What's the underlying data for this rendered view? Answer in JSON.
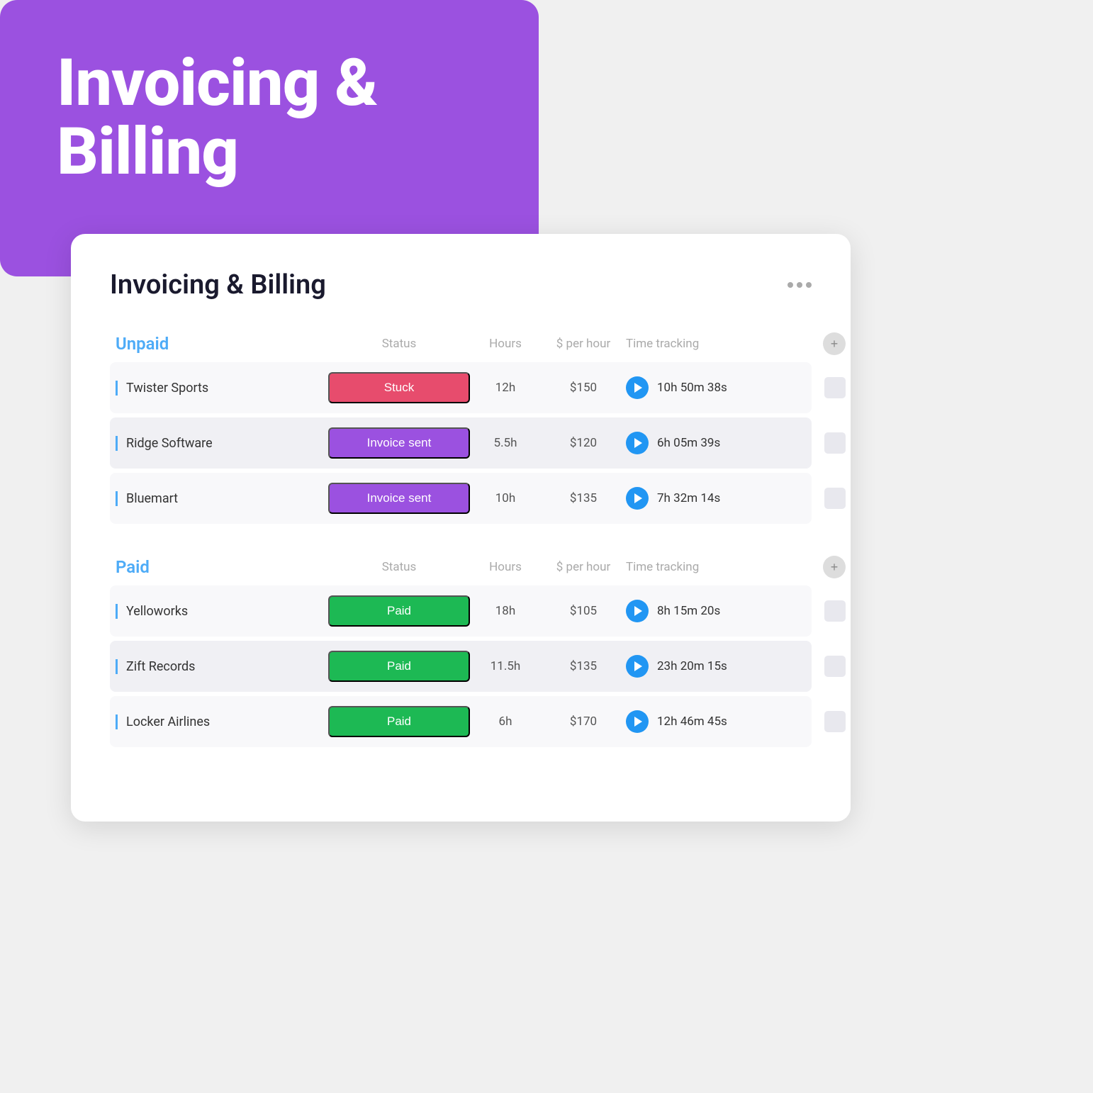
{
  "banner": {
    "title": "Invoicing &\nBilling"
  },
  "card": {
    "title": "Invoicing & Billing",
    "more_icon": "•••",
    "unpaid": {
      "section_label": "Unpaid",
      "columns": {
        "status": "Status",
        "hours": "Hours",
        "rate": "$ per hour",
        "time_tracking": "Time tracking"
      },
      "rows": [
        {
          "client": "Twister Sports",
          "status": "Stuck",
          "status_class": "status-stuck",
          "hours": "12h",
          "rate": "$150",
          "time": "10h 50m 38s"
        },
        {
          "client": "Ridge Software",
          "status": "Invoice sent",
          "status_class": "status-invoice-sent",
          "hours": "5.5h",
          "rate": "$120",
          "time": "6h 05m 39s"
        },
        {
          "client": "Bluemart",
          "status": "Invoice sent",
          "status_class": "status-invoice-sent",
          "hours": "10h",
          "rate": "$135",
          "time": "7h 32m 14s"
        }
      ]
    },
    "paid": {
      "section_label": "Paid",
      "columns": {
        "status": "Status",
        "hours": "Hours",
        "rate": "$ per hour",
        "time_tracking": "Time tracking"
      },
      "rows": [
        {
          "client": "Yelloworks",
          "status": "Paid",
          "status_class": "status-paid",
          "hours": "18h",
          "rate": "$105",
          "time": "8h 15m 20s"
        },
        {
          "client": "Zift Records",
          "status": "Paid",
          "status_class": "status-paid",
          "hours": "11.5h",
          "rate": "$135",
          "time": "23h 20m 15s"
        },
        {
          "client": "Locker Airlines",
          "status": "Paid",
          "status_class": "status-paid",
          "hours": "6h",
          "rate": "$170",
          "time": "12h 46m 45s"
        }
      ]
    }
  }
}
